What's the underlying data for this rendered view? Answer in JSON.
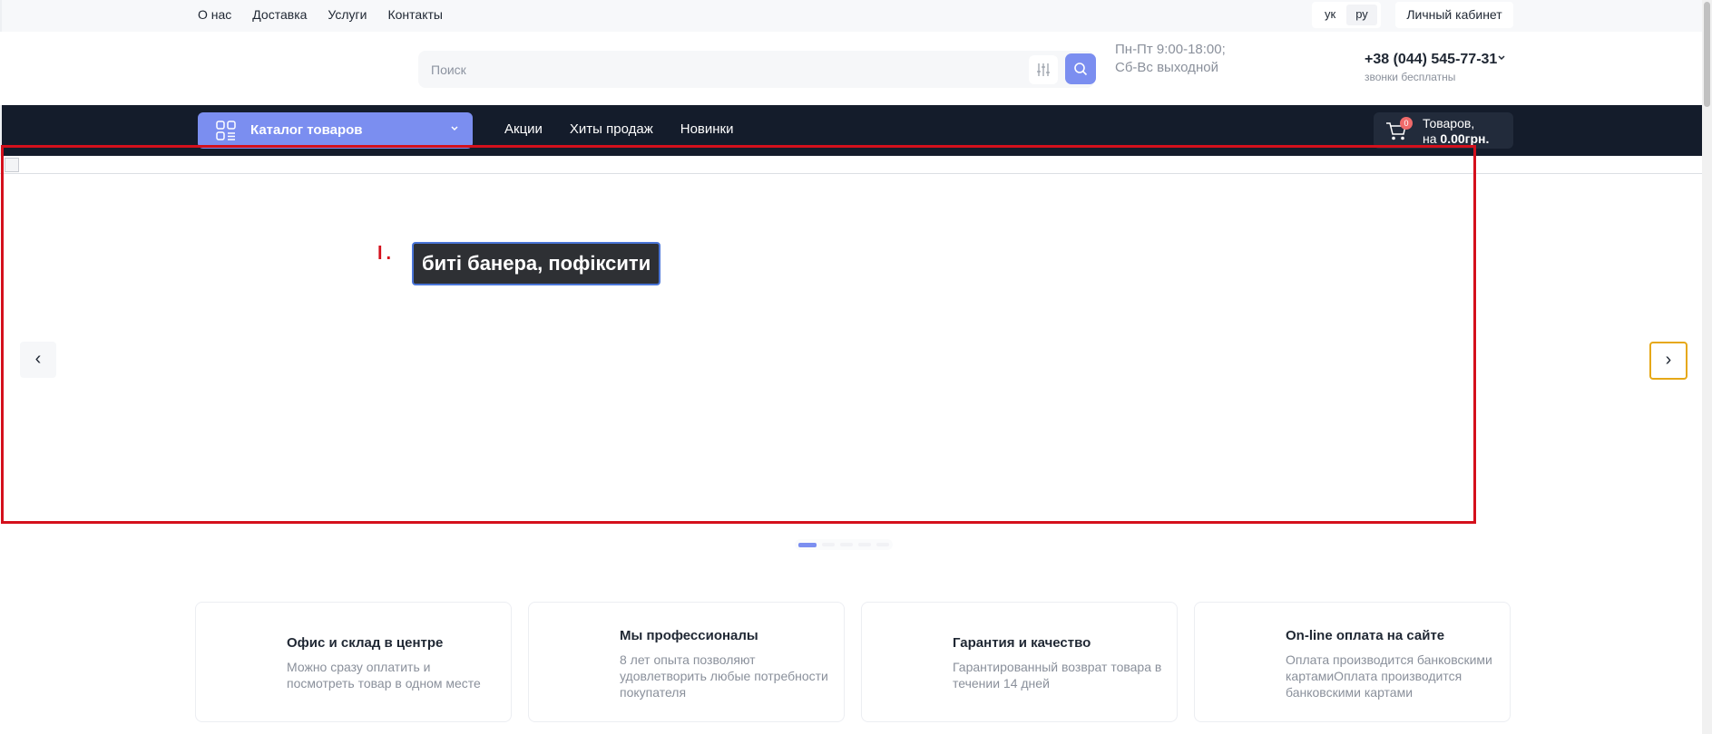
{
  "topbar": {
    "links": [
      "О нас",
      "Доставка",
      "Услуги",
      "Контакты"
    ],
    "languages": [
      "ук",
      "ру"
    ],
    "active_language": "ру",
    "account_label": "Личный кабинет"
  },
  "header": {
    "search_placeholder": "Поиск",
    "hours_line1": "Пн-Пт 9:00-18:00;",
    "hours_line2": "Сб-Вс выходной",
    "phone": "+38 (044) 545-77-31",
    "phone_note": "звонки бесплатны"
  },
  "navbar": {
    "catalog_label": "Каталог товаров",
    "links": [
      "Акции",
      "Хиты продаж",
      "Новинки"
    ],
    "cart": {
      "count": "0",
      "line1": "Товаров,",
      "line2_prefix": "на",
      "amount": "0.00грн."
    }
  },
  "slider": {
    "mark_text": "l.",
    "callout_text": "биті банера, пофіксити",
    "prev_label": "‹",
    "next_label": "›",
    "dots": 5,
    "active_dot": 1
  },
  "features": [
    {
      "title": "Офис и склад в центре",
      "text": "Можно сразу оплатить и посмотреть товар в одном месте"
    },
    {
      "title": "Мы профессионалы",
      "text": "8 лет опыта позволяют удовлетворить любые потребности покупателя"
    },
    {
      "title": "Гарантия и качество",
      "text": "Гарантированный возврат товара в течении 14 дней"
    },
    {
      "title": "On-line оплата на сайте",
      "text": "Оплата производится банковскими картамиОплата производится банковскими картами"
    }
  ],
  "colors": {
    "accent": "#7b8ef0",
    "navbar_bg": "#141c2b",
    "annotation_red": "#d4101c",
    "next_button_border": "#e6a817",
    "cart_badge": "#ef6a6a"
  }
}
